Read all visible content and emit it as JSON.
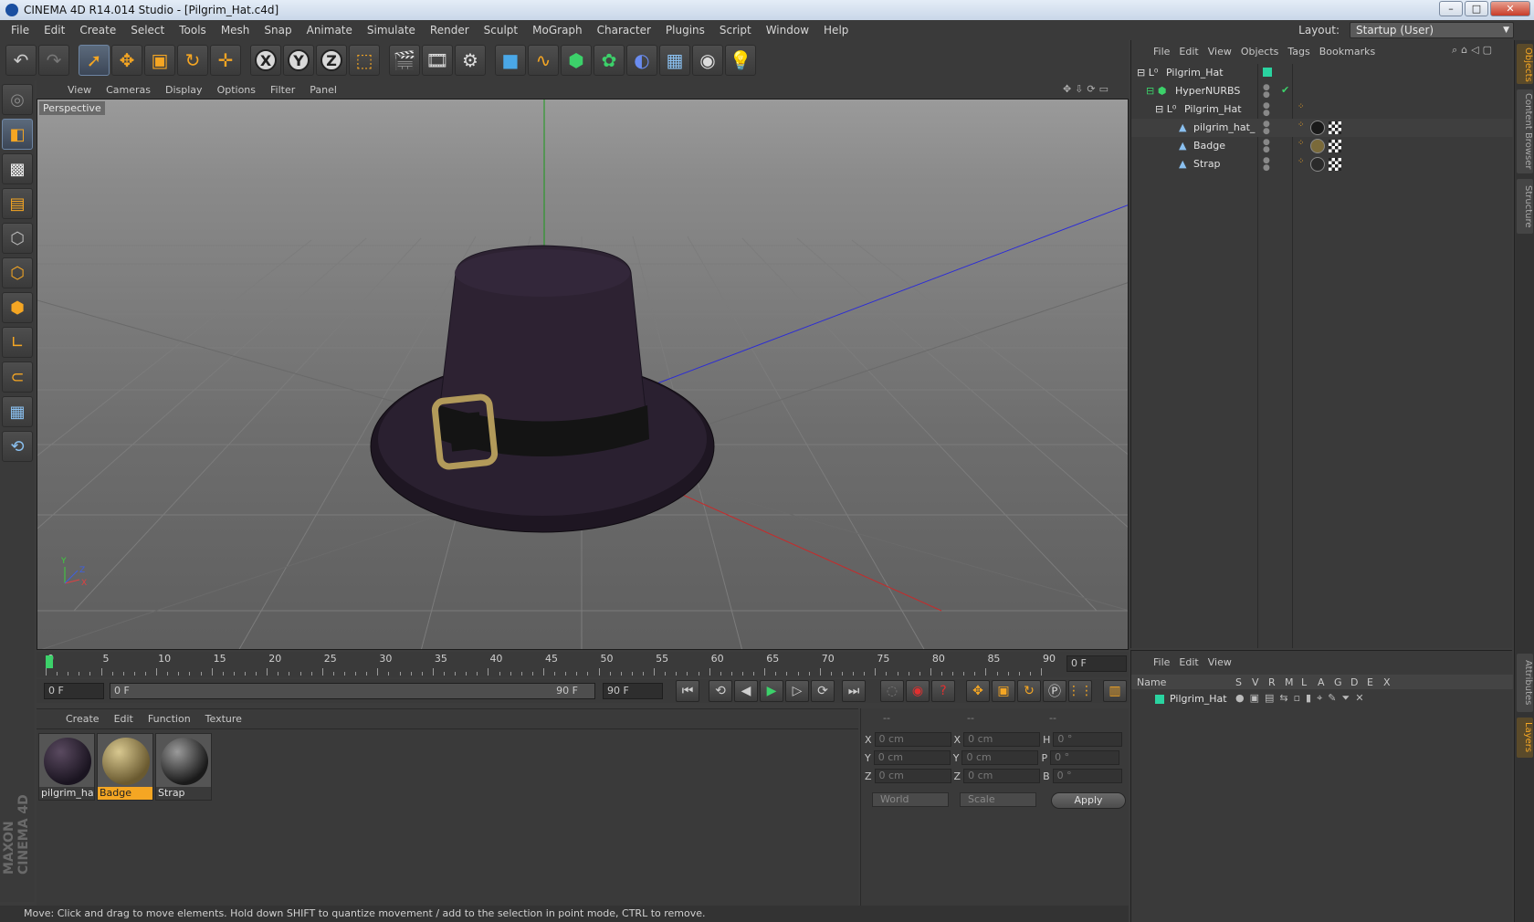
{
  "window": {
    "title": "CINEMA 4D R14.014 Studio - [Pilgrim_Hat.c4d]",
    "layout_label": "Layout:",
    "layout_value": "Startup (User)"
  },
  "menubar": [
    "File",
    "Edit",
    "Create",
    "Select",
    "Tools",
    "Mesh",
    "Snap",
    "Animate",
    "Simulate",
    "Render",
    "Sculpt",
    "MoGraph",
    "Character",
    "Plugins",
    "Script",
    "Window",
    "Help"
  ],
  "axis_buttons": [
    "X",
    "Y",
    "Z"
  ],
  "viewport": {
    "menu": [
      "View",
      "Cameras",
      "Display",
      "Options",
      "Filter",
      "Panel"
    ],
    "label": "Perspective",
    "axis_y": "Y",
    "axis_z": "Z",
    "axis_x": "X"
  },
  "timeline": {
    "ticks": [
      "0",
      "5",
      "10",
      "15",
      "20",
      "25",
      "30",
      "35",
      "40",
      "45",
      "50",
      "55",
      "60",
      "65",
      "70",
      "75",
      "80",
      "85",
      "90"
    ],
    "current_frame": "0 F",
    "start_frame": "0 F",
    "range_start": "0 F",
    "range_end": "90 F",
    "end_frame": "90 F"
  },
  "material_manager": {
    "menu": [
      "Create",
      "Edit",
      "Function",
      "Texture"
    ],
    "materials": [
      {
        "name": "pilgrim_hat",
        "color": "#2a2030",
        "selected": false
      },
      {
        "name": "Badge",
        "color": "#8a7a4a",
        "selected": true
      },
      {
        "name": "Strap",
        "color": "#2c2c2c",
        "selected": false
      }
    ]
  },
  "coordinates": {
    "header": [
      "--",
      "--",
      "--"
    ],
    "rows": [
      {
        "a": "X",
        "av": "0 cm",
        "b": "X",
        "bv": "0 cm",
        "c": "H",
        "cv": "0 °"
      },
      {
        "a": "Y",
        "av": "0 cm",
        "b": "Y",
        "bv": "0 cm",
        "c": "P",
        "cv": "0 °"
      },
      {
        "a": "Z",
        "av": "0 cm",
        "b": "Z",
        "bv": "0 cm",
        "c": "B",
        "cv": "0 °"
      }
    ],
    "space": "World",
    "mode": "Scale",
    "apply": "Apply"
  },
  "status": "Move: Click and drag to move elements. Hold down SHIFT to quantize movement / add to the selection in point mode, CTRL to remove.",
  "object_manager": {
    "menu": [
      "File",
      "Edit",
      "View",
      "Objects",
      "Tags",
      "Bookmarks"
    ],
    "objects": [
      {
        "name": "Pilgrim_Hat",
        "indent": 0
      },
      {
        "name": "HyperNURBS",
        "indent": 1
      },
      {
        "name": "Pilgrim_Hat",
        "indent": 2
      },
      {
        "name": "pilgrim_hat_",
        "indent": 3
      },
      {
        "name": "Badge",
        "indent": 3
      },
      {
        "name": "Strap",
        "indent": 3
      }
    ]
  },
  "layer_manager": {
    "menu": [
      "File",
      "Edit",
      "View"
    ],
    "columns": [
      "Name",
      "S",
      "V",
      "R",
      "M",
      "L",
      "A",
      "G",
      "D",
      "E",
      "X"
    ],
    "layers": [
      {
        "name": "Pilgrim_Hat",
        "color": "#2ad3a0"
      }
    ]
  },
  "side_tabs": [
    "Objects",
    "Content Browser",
    "Structure",
    "Attributes",
    "Layers"
  ],
  "brand": "MAXON CINEMA 4D",
  "colors": {
    "accent": "#f5a623",
    "bg": "#3a3a3a",
    "selection": "#2ad3a0"
  }
}
